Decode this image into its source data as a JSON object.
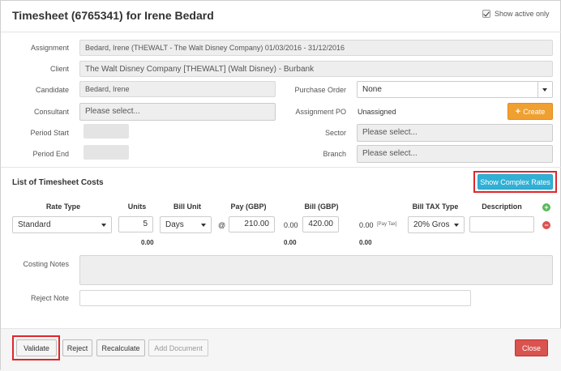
{
  "header": {
    "title": "Timesheet (6765341) for Irene Bedard",
    "show_active_only": "Show active only",
    "show_active_checked": true
  },
  "form": {
    "assignment_label": "Assignment",
    "assignment_value": "Bedard, Irene (THEWALT - The Walt Disney Company) 01/03/2016 - 31/12/2016",
    "client_label": "Client",
    "client_value": "The Walt Disney Company [THEWALT] (Walt Disney) - Burbank",
    "candidate_label": "Candidate",
    "candidate_value": "Bedard, Irene",
    "consultant_label": "Consultant",
    "consultant_placeholder": "Please select...",
    "period_start_label": "Period Start",
    "period_end_label": "Period End",
    "purchase_order_label": "Purchase Order",
    "purchase_order_value": "None",
    "assignment_po_label": "Assignment PO",
    "assignment_po_value": "Unassigned",
    "create_label": "Create",
    "sector_label": "Sector",
    "sector_placeholder": "Please select...",
    "branch_label": "Branch",
    "branch_placeholder": "Please select..."
  },
  "costs": {
    "section_title": "List of Timesheet Costs",
    "show_complex_rates": "Show Complex Rates",
    "headers": {
      "rate_type": "Rate Type",
      "units": "Units",
      "bill_unit": "Bill Unit",
      "pay": "Pay (GBP)",
      "bill": "Bill (GBP)",
      "bill_tax_type": "Bill TAX Type",
      "description": "Description"
    },
    "row": {
      "rate_type": "Standard",
      "units": "5",
      "bill_unit": "Days",
      "at": "@",
      "pay": "210.00",
      "pay_total": "0.00",
      "bill": "420.00",
      "bill_total": "0.00",
      "pay_tax": "[Pay Tax]",
      "bill_tax_type": "20% Gros",
      "description": ""
    },
    "totals": {
      "units_total": "0.00",
      "pay_total": "0.00",
      "bill_total": "0.00"
    },
    "add_symbol": "+",
    "remove_symbol": "−"
  },
  "notes": {
    "costing_notes_label": "Costing Notes",
    "reject_note_label": "Reject Note"
  },
  "footer": {
    "validate": "Validate",
    "reject": "Reject",
    "recalculate": "Recalculate",
    "add_document": "Add Document",
    "close": "Close"
  },
  "colors": {
    "accent_blue": "#31b0d5",
    "accent_orange": "#f0a030",
    "danger_red": "#d9534f",
    "highlight_red": "#e0262b"
  }
}
